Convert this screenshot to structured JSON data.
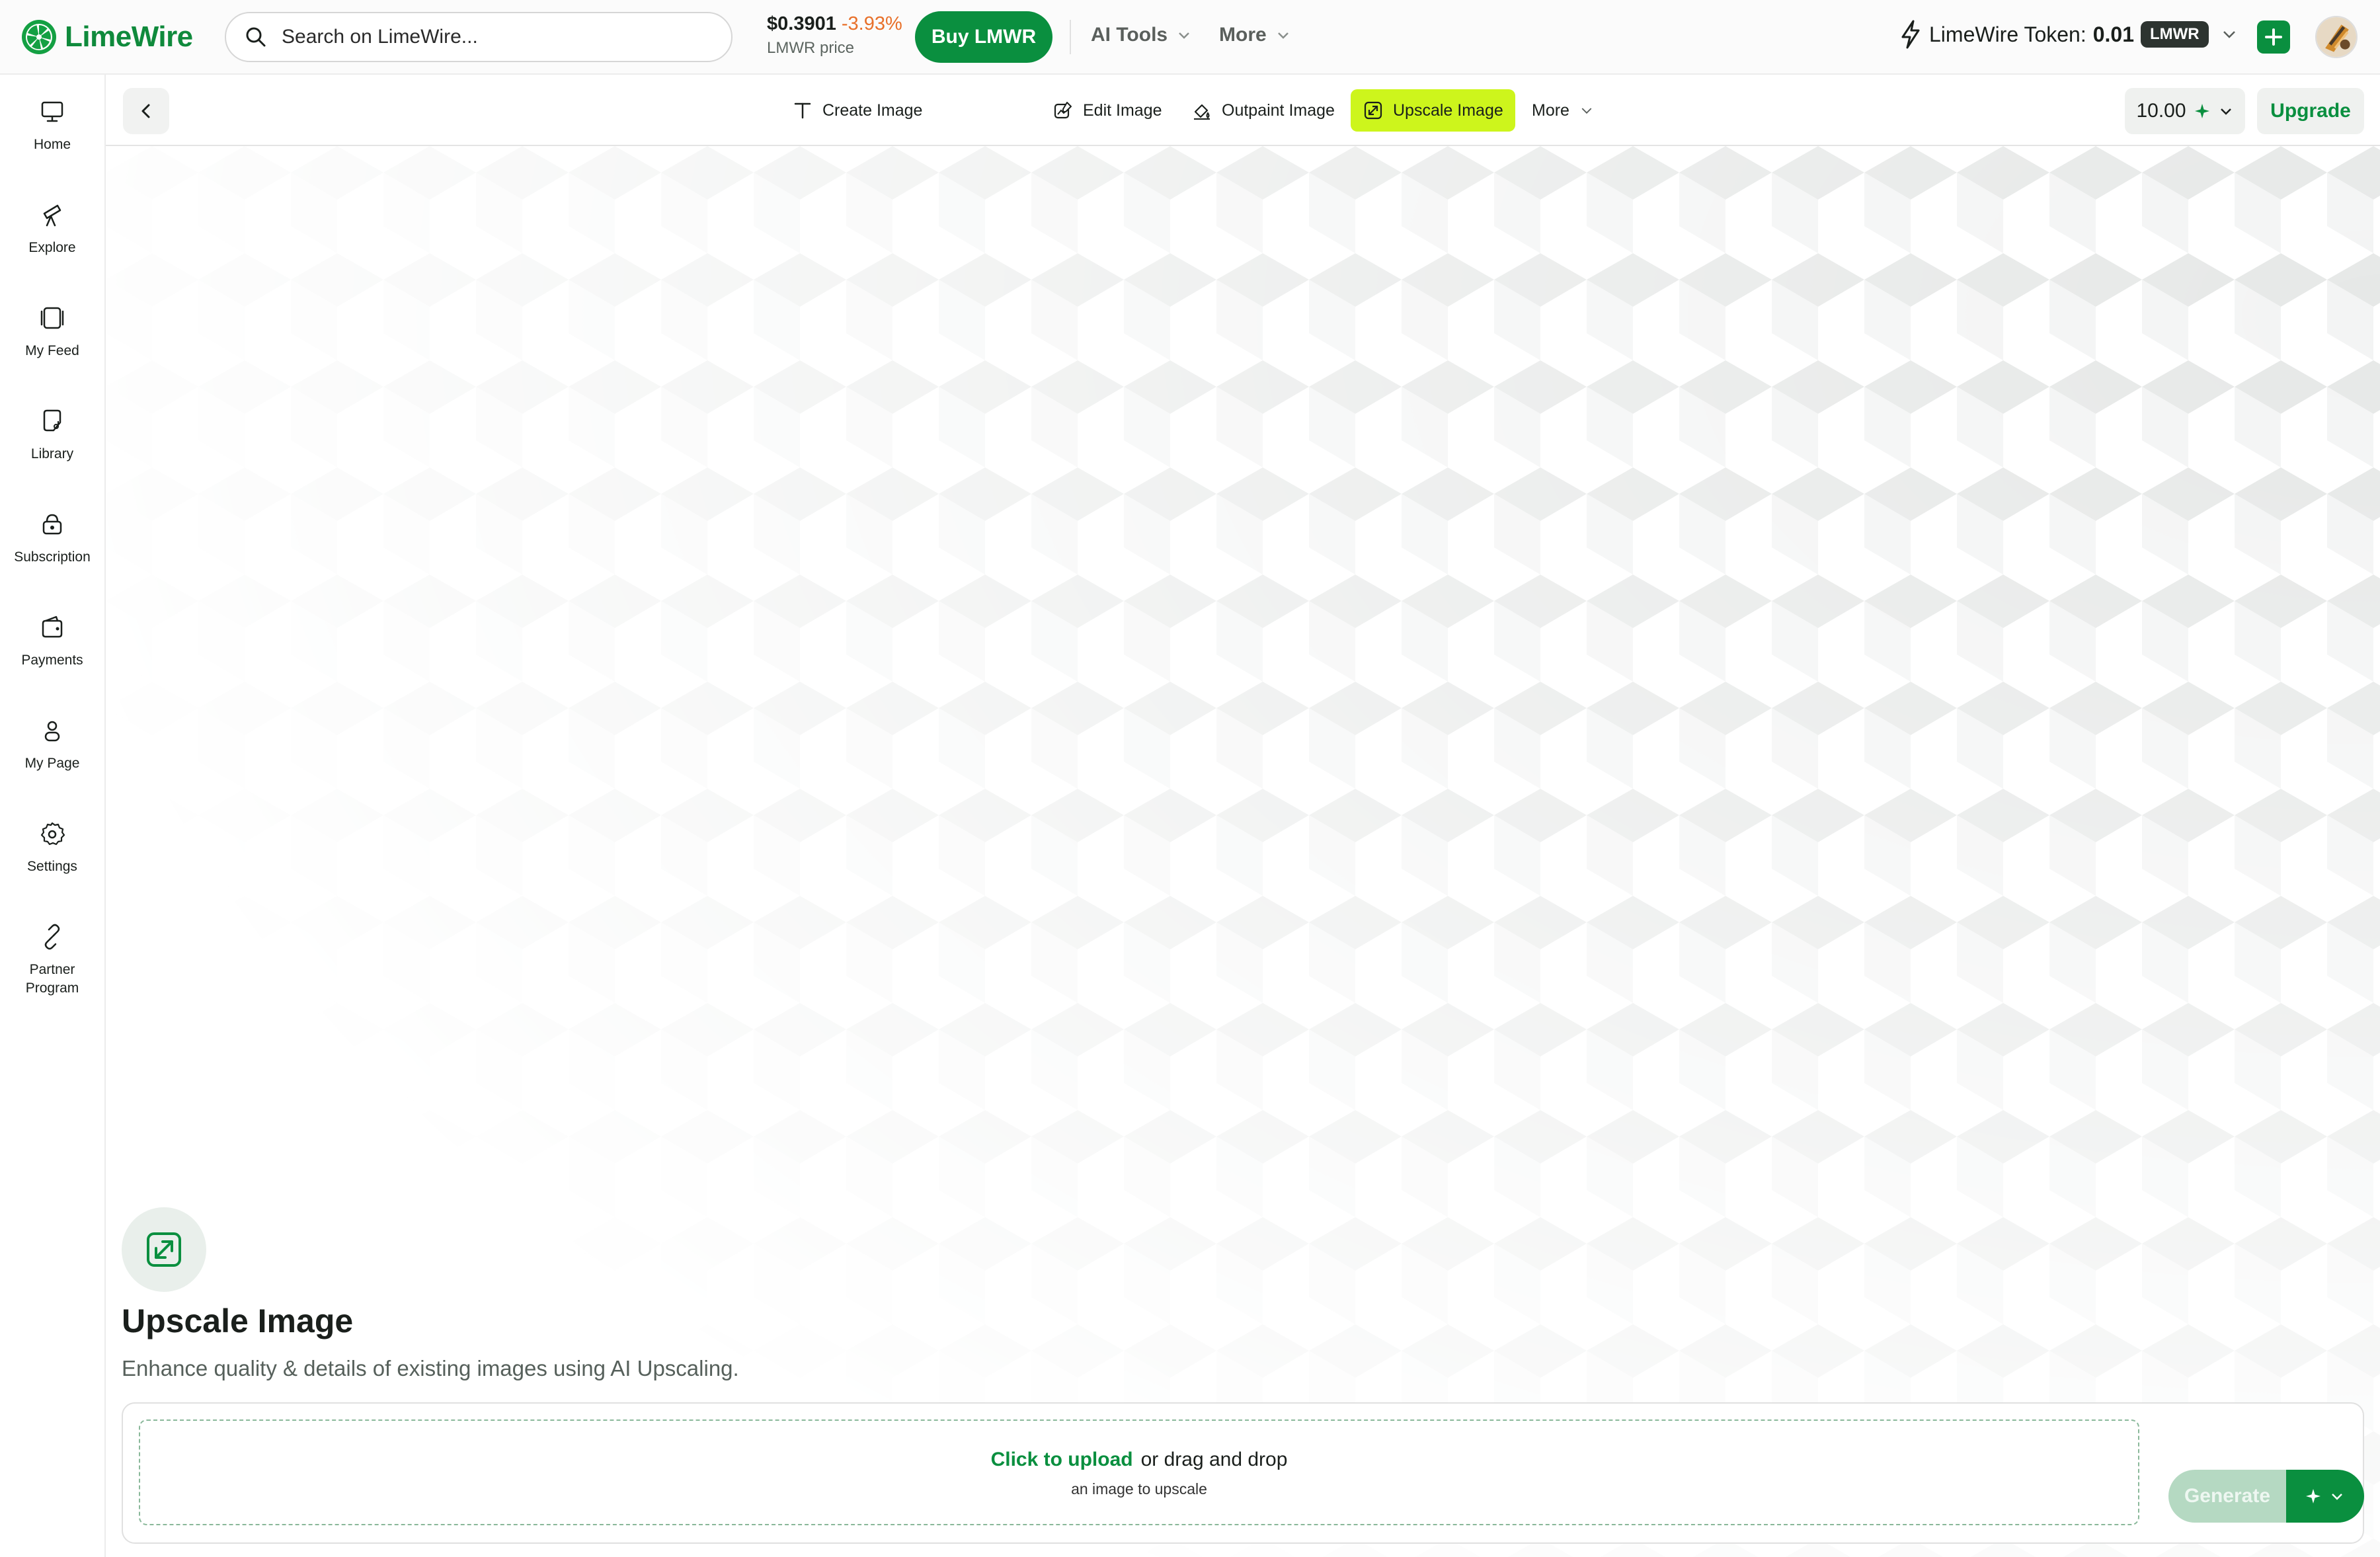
{
  "brand": {
    "name": "LimeWire"
  },
  "search": {
    "placeholder": "Search on LimeWire..."
  },
  "price": {
    "value": "$0.3901",
    "change": "-3.93%",
    "label": "LMWR price"
  },
  "buttons": {
    "buy": "Buy LMWR",
    "upgrade": "Upgrade",
    "generate": "Generate"
  },
  "topnav": {
    "ai_tools": "AI Tools",
    "more": "More"
  },
  "token": {
    "label": "LimeWire Token:",
    "value": "0.01",
    "unit": "LMWR"
  },
  "sidebar": {
    "items": [
      {
        "label": "Home",
        "icon": "monitor-icon"
      },
      {
        "label": "Explore",
        "icon": "telescope-icon"
      },
      {
        "label": "My Feed",
        "icon": "feed-icon"
      },
      {
        "label": "Library",
        "icon": "library-icon"
      },
      {
        "label": "Subscription",
        "icon": "subscription-icon"
      },
      {
        "label": "Payments",
        "icon": "wallet-icon"
      },
      {
        "label": "My Page",
        "icon": "user-icon"
      },
      {
        "label": "Settings",
        "icon": "gear-icon"
      },
      {
        "label": "Partner Program",
        "icon": "link-icon"
      }
    ]
  },
  "tabs": [
    {
      "label": "Create Image",
      "icon": "text-icon",
      "active": false
    },
    {
      "label": "Edit Image",
      "icon": "edit-image-icon",
      "active": false
    },
    {
      "label": "Outpaint Image",
      "icon": "outpaint-icon",
      "active": false
    },
    {
      "label": "Upscale Image",
      "icon": "upscale-icon",
      "active": true
    },
    {
      "label": "More",
      "icon": "chevron-down-icon",
      "active": false
    }
  ],
  "credits": {
    "value": "10.00"
  },
  "page": {
    "title": "Upscale Image",
    "subtitle": "Enhance quality & details of existing images using AI Upscaling."
  },
  "upload": {
    "link_text": "Click to upload",
    "rest_text": "or drag and drop",
    "hint": "an image to upscale"
  },
  "colors": {
    "brand_green": "#0a8f3f",
    "active_tab": "#cdf51c",
    "price_change": "#e8702a",
    "generate_disabled": "#b5d9c2"
  }
}
